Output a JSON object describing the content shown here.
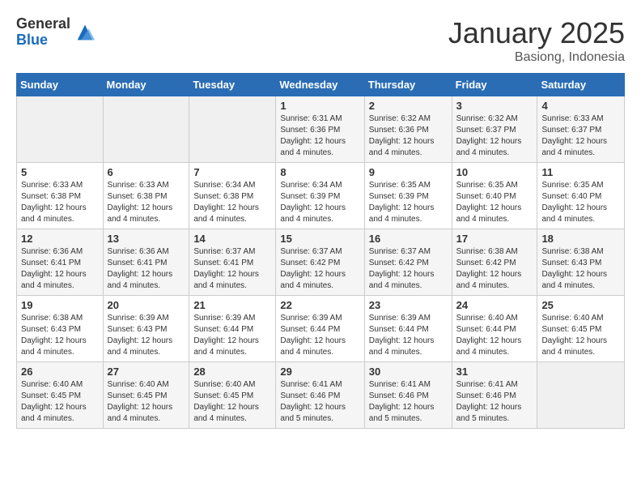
{
  "logo": {
    "general": "General",
    "blue": "Blue"
  },
  "header": {
    "month": "January 2025",
    "location": "Basiong, Indonesia"
  },
  "weekdays": [
    "Sunday",
    "Monday",
    "Tuesday",
    "Wednesday",
    "Thursday",
    "Friday",
    "Saturday"
  ],
  "weeks": [
    [
      {
        "day": "",
        "info": ""
      },
      {
        "day": "",
        "info": ""
      },
      {
        "day": "",
        "info": ""
      },
      {
        "day": "1",
        "info": "Sunrise: 6:31 AM\nSunset: 6:36 PM\nDaylight: 12 hours\nand 4 minutes."
      },
      {
        "day": "2",
        "info": "Sunrise: 6:32 AM\nSunset: 6:36 PM\nDaylight: 12 hours\nand 4 minutes."
      },
      {
        "day": "3",
        "info": "Sunrise: 6:32 AM\nSunset: 6:37 PM\nDaylight: 12 hours\nand 4 minutes."
      },
      {
        "day": "4",
        "info": "Sunrise: 6:33 AM\nSunset: 6:37 PM\nDaylight: 12 hours\nand 4 minutes."
      }
    ],
    [
      {
        "day": "5",
        "info": "Sunrise: 6:33 AM\nSunset: 6:38 PM\nDaylight: 12 hours\nand 4 minutes."
      },
      {
        "day": "6",
        "info": "Sunrise: 6:33 AM\nSunset: 6:38 PM\nDaylight: 12 hours\nand 4 minutes."
      },
      {
        "day": "7",
        "info": "Sunrise: 6:34 AM\nSunset: 6:38 PM\nDaylight: 12 hours\nand 4 minutes."
      },
      {
        "day": "8",
        "info": "Sunrise: 6:34 AM\nSunset: 6:39 PM\nDaylight: 12 hours\nand 4 minutes."
      },
      {
        "day": "9",
        "info": "Sunrise: 6:35 AM\nSunset: 6:39 PM\nDaylight: 12 hours\nand 4 minutes."
      },
      {
        "day": "10",
        "info": "Sunrise: 6:35 AM\nSunset: 6:40 PM\nDaylight: 12 hours\nand 4 minutes."
      },
      {
        "day": "11",
        "info": "Sunrise: 6:35 AM\nSunset: 6:40 PM\nDaylight: 12 hours\nand 4 minutes."
      }
    ],
    [
      {
        "day": "12",
        "info": "Sunrise: 6:36 AM\nSunset: 6:41 PM\nDaylight: 12 hours\nand 4 minutes."
      },
      {
        "day": "13",
        "info": "Sunrise: 6:36 AM\nSunset: 6:41 PM\nDaylight: 12 hours\nand 4 minutes."
      },
      {
        "day": "14",
        "info": "Sunrise: 6:37 AM\nSunset: 6:41 PM\nDaylight: 12 hours\nand 4 minutes."
      },
      {
        "day": "15",
        "info": "Sunrise: 6:37 AM\nSunset: 6:42 PM\nDaylight: 12 hours\nand 4 minutes."
      },
      {
        "day": "16",
        "info": "Sunrise: 6:37 AM\nSunset: 6:42 PM\nDaylight: 12 hours\nand 4 minutes."
      },
      {
        "day": "17",
        "info": "Sunrise: 6:38 AM\nSunset: 6:42 PM\nDaylight: 12 hours\nand 4 minutes."
      },
      {
        "day": "18",
        "info": "Sunrise: 6:38 AM\nSunset: 6:43 PM\nDaylight: 12 hours\nand 4 minutes."
      }
    ],
    [
      {
        "day": "19",
        "info": "Sunrise: 6:38 AM\nSunset: 6:43 PM\nDaylight: 12 hours\nand 4 minutes."
      },
      {
        "day": "20",
        "info": "Sunrise: 6:39 AM\nSunset: 6:43 PM\nDaylight: 12 hours\nand 4 minutes."
      },
      {
        "day": "21",
        "info": "Sunrise: 6:39 AM\nSunset: 6:44 PM\nDaylight: 12 hours\nand 4 minutes."
      },
      {
        "day": "22",
        "info": "Sunrise: 6:39 AM\nSunset: 6:44 PM\nDaylight: 12 hours\nand 4 minutes."
      },
      {
        "day": "23",
        "info": "Sunrise: 6:39 AM\nSunset: 6:44 PM\nDaylight: 12 hours\nand 4 minutes."
      },
      {
        "day": "24",
        "info": "Sunrise: 6:40 AM\nSunset: 6:44 PM\nDaylight: 12 hours\nand 4 minutes."
      },
      {
        "day": "25",
        "info": "Sunrise: 6:40 AM\nSunset: 6:45 PM\nDaylight: 12 hours\nand 4 minutes."
      }
    ],
    [
      {
        "day": "26",
        "info": "Sunrise: 6:40 AM\nSunset: 6:45 PM\nDaylight: 12 hours\nand 4 minutes."
      },
      {
        "day": "27",
        "info": "Sunrise: 6:40 AM\nSunset: 6:45 PM\nDaylight: 12 hours\nand 4 minutes."
      },
      {
        "day": "28",
        "info": "Sunrise: 6:40 AM\nSunset: 6:45 PM\nDaylight: 12 hours\nand 4 minutes."
      },
      {
        "day": "29",
        "info": "Sunrise: 6:41 AM\nSunset: 6:46 PM\nDaylight: 12 hours\nand 5 minutes."
      },
      {
        "day": "30",
        "info": "Sunrise: 6:41 AM\nSunset: 6:46 PM\nDaylight: 12 hours\nand 5 minutes."
      },
      {
        "day": "31",
        "info": "Sunrise: 6:41 AM\nSunset: 6:46 PM\nDaylight: 12 hours\nand 5 minutes."
      },
      {
        "day": "",
        "info": ""
      }
    ]
  ]
}
